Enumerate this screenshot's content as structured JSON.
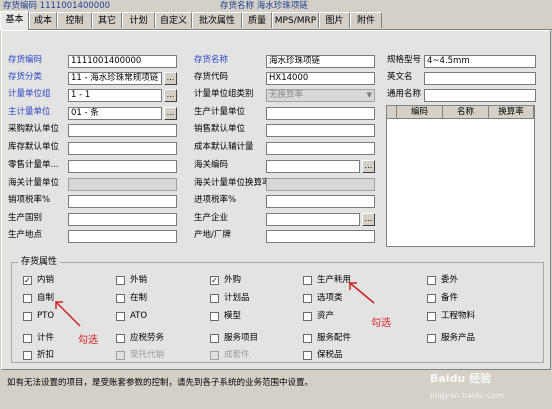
{
  "header": {
    "left_text": "存货编码 1111001400000",
    "right_text": "存货名称 海水珍珠项链"
  },
  "tabs": [
    "基本",
    "成本",
    "控制",
    "其它",
    "计划",
    "自定义",
    "批次属性",
    "质量",
    "MPS/MRP",
    "图片",
    "附件"
  ],
  "form_left": [
    {
      "label": "存货编码",
      "value": "1111001400000",
      "blue": true
    },
    {
      "label": "存货分类",
      "value": "11 - 海水珍珠常规项链",
      "blue": true
    },
    {
      "label": "计量单位组",
      "value": "1 - 1",
      "blue": true
    },
    {
      "label": "主计量单位",
      "value": "01 - 条",
      "blue": true
    },
    {
      "label": "采购默认单位",
      "value": ""
    },
    {
      "label": "库存默认单位",
      "value": ""
    },
    {
      "label": "零售计量单...",
      "value": ""
    },
    {
      "label": "海关计量单位",
      "value": ""
    },
    {
      "label": "销项税率%",
      "value": ""
    },
    {
      "label": "生产国别",
      "value": ""
    },
    {
      "label": "生产地点",
      "value": ""
    }
  ],
  "form_mid": [
    {
      "label": "存货名称",
      "value": "海水珍珠项链",
      "blue": true
    },
    {
      "label": "存货代码",
      "value": "HX14000"
    },
    {
      "label": "计量单位组类别",
      "value": "无换算率"
    },
    {
      "label": "生产计量单位",
      "value": ""
    },
    {
      "label": "销售默认单位",
      "value": ""
    },
    {
      "label": "成本默认辅计量",
      "value": ""
    },
    {
      "label": "海关编码",
      "value": ""
    },
    {
      "label": "海关计量单位换算率",
      "value": ""
    },
    {
      "label": "进项税率%",
      "value": ""
    },
    {
      "label": "生产企业",
      "value": ""
    },
    {
      "label": "产地/厂牌",
      "value": ""
    }
  ],
  "form_right": [
    {
      "label": "规格型号",
      "value": "4~4.5mm"
    },
    {
      "label": "英文名",
      "value": ""
    },
    {
      "label": "通用名称",
      "value": ""
    }
  ],
  "grid_headers": [
    "编码",
    "名称",
    "换算率"
  ],
  "attributes": {
    "title": "存货属性",
    "items": [
      {
        "label": "内销",
        "checked": true
      },
      {
        "label": "外销",
        "checked": false
      },
      {
        "label": "外购",
        "checked": true
      },
      {
        "label": "生产耗用",
        "checked": false
      },
      {
        "label": "委外",
        "checked": false
      },
      {
        "label": "自制",
        "checked": false
      },
      {
        "label": "在制",
        "checked": false
      },
      {
        "label": "计划品",
        "checked": false
      },
      {
        "label": "选项类",
        "checked": false
      },
      {
        "label": "备件",
        "checked": false
      },
      {
        "label": "PTO",
        "checked": false
      },
      {
        "label": "ATO",
        "checked": false
      },
      {
        "label": "模型",
        "checked": false
      },
      {
        "label": "资产",
        "checked": false
      },
      {
        "label": "工程物料",
        "checked": false
      },
      {
        "label": "计件",
        "checked": false
      },
      {
        "label": "应税劳务",
        "checked": false
      },
      {
        "label": "服务项目",
        "checked": false
      },
      {
        "label": "服务配件",
        "checked": false
      },
      {
        "label": "服务产品",
        "checked": false
      },
      {
        "label": "折扣",
        "checked": false
      },
      {
        "label": "受托代销",
        "checked": false,
        "disabled": true
      },
      {
        "label": "成套件",
        "checked": false,
        "disabled": true
      },
      {
        "label": "保税品",
        "checked": false
      }
    ]
  },
  "status_text": "如有无法设置的项目，是受账套参数的控制，请先到各子系统的业务范围中设置。",
  "annotations": [
    "勾选",
    "勾选"
  ],
  "watermark": {
    "main": "Baidu 经验",
    "sub": "jingyan.baidu.com"
  },
  "colors": {
    "label_blue": "#2b47c7",
    "annotation_red": "#d21f1f"
  }
}
